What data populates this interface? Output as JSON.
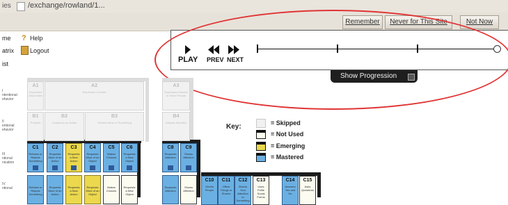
{
  "browser": {
    "left_fragment": "ies",
    "url": "/exchange/rowland/1..."
  },
  "prompt_bar": {
    "remember": "Remember",
    "never": "Never for This Site",
    "not_now": "Not Now"
  },
  "menu": {
    "line1_prefix": "me",
    "help": "Help",
    "line2_prefix": "atrix",
    "logout": "Logout",
    "line3_prefix": "ist"
  },
  "player": {
    "play": "PLAY",
    "prev": "PREV",
    "next": "NEXT",
    "show_progression": "Show Progression",
    "position": 1.0
  },
  "row_labels": {
    "I": [
      "I",
      "ntentional",
      "ehavior"
    ],
    "II": [
      "II",
      "entional",
      "ehavior"
    ],
    "III": [
      "III",
      "ntional",
      "nication"
    ],
    "IV": [
      "IV",
      "ntional"
    ]
  },
  "cells": {
    "A1": {
      "code": "A1",
      "desc": "Expresses Discomfort"
    },
    "A2": {
      "code": "A2",
      "desc": "Expresses Comfort"
    },
    "A3": {
      "code": "A3",
      "desc": "Expresses Interest in Other People"
    },
    "B1": {
      "code": "B1",
      "desc": "Protests"
    },
    "B2": {
      "code": "B2",
      "desc": "Continues an Action"
    },
    "B3": {
      "code": "B3",
      "desc": "Obtains More of Something"
    },
    "B4": {
      "code": "B4",
      "desc": "Attracts Attention"
    },
    "C1": {
      "code": "C1",
      "desc": "Refuses or Rejects Something"
    },
    "C2": {
      "code": "C2",
      "desc": "Requests More of an Action"
    },
    "C3": {
      "code": "C3",
      "desc": "Requests a New Action"
    },
    "C4": {
      "code": "C4",
      "desc": "Requests More of an Object"
    },
    "C5": {
      "code": "C5",
      "desc": "Makes Choices"
    },
    "C6": {
      "code": "C6",
      "desc": "Requests a New Object"
    },
    "C8": {
      "code": "C8",
      "desc": "Requests Attention"
    },
    "C9": {
      "code": "C9",
      "desc": "Shows Affection"
    },
    "D1": {
      "code": "",
      "desc": "Refuses or Rejects Something"
    },
    "D2": {
      "code": "",
      "desc": "Requests More of an Action"
    },
    "D3": {
      "code": "",
      "desc": "Requests a New Action"
    },
    "D4": {
      "code": "",
      "desc": "Requests More of an Object"
    },
    "D5": {
      "code": "",
      "desc": "Makes Choices"
    },
    "D6": {
      "code": "",
      "desc": "Requests a New Object"
    },
    "D8": {
      "code": "",
      "desc": "Requests Attention"
    },
    "D9": {
      "code": "",
      "desc": "Shows Affection"
    },
    "C10": {
      "code": "C10",
      "desc": "Greets People"
    },
    "C11": {
      "code": "C11",
      "desc": "Offers Things or Shares"
    },
    "C12": {
      "code": "C12",
      "desc": "Directs Your Attention to Something"
    },
    "C13": {
      "code": "C13",
      "desc": "Uses Polite Social Forms"
    },
    "C14": {
      "code": "C14",
      "desc": "Answers Yes and No"
    },
    "C15": {
      "code": "C15",
      "desc": "Asks Questions"
    }
  },
  "key": {
    "title": "Key:",
    "skipped": "= Skipped",
    "not_used": "= Not Used",
    "emerging": "= Emerging",
    "mastered": "= Mastered"
  },
  "colors": {
    "mastered": "#6bb0e3",
    "emerging": "#ebd84d",
    "not_used": "#fbfbf0",
    "skipped": "#f1f1f1",
    "annotation": "#e03434"
  }
}
